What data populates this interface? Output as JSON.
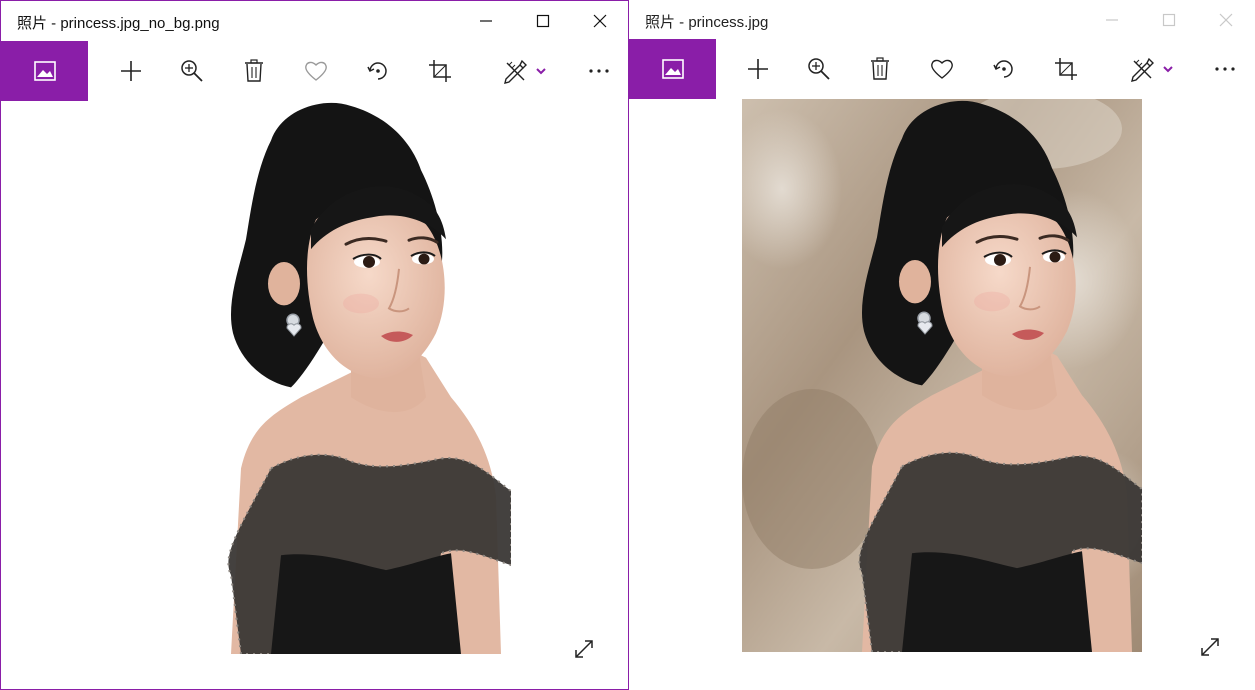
{
  "windows": [
    {
      "id": "left",
      "title": "照片 - princess.jpg_no_bg.png",
      "active": true,
      "image": {
        "background": "transparent (removed)"
      },
      "toolbar": [
        "gallery",
        "add",
        "zoom",
        "delete",
        "favorite",
        "rotate",
        "crop",
        "edit-create",
        "more"
      ]
    },
    {
      "id": "right",
      "title": "照片 - princess.jpg",
      "active": false,
      "image": {
        "background": "blurred"
      },
      "toolbar": [
        "gallery",
        "add",
        "zoom",
        "delete",
        "favorite",
        "rotate",
        "crop",
        "edit-create",
        "more"
      ]
    }
  ],
  "colors": {
    "accent": "#8a1ea8",
    "icon": "#222222",
    "icon_disabled": "#9a9a9a",
    "caption_inactive": "#c8c8c8",
    "hair": "#141414",
    "skin": "#e9c2ad",
    "dress": "#1a1a1a",
    "bg_blur": "#b6a591"
  },
  "icons": {
    "gallery": "gallery-icon",
    "add": "plus-icon",
    "zoom": "zoom-in-icon",
    "delete": "trash-icon",
    "favorite": "heart-icon",
    "rotate": "rotate-icon",
    "crop": "crop-icon",
    "edit": "edit-create-icon",
    "more": "more-icon",
    "expand": "expand-icon"
  }
}
